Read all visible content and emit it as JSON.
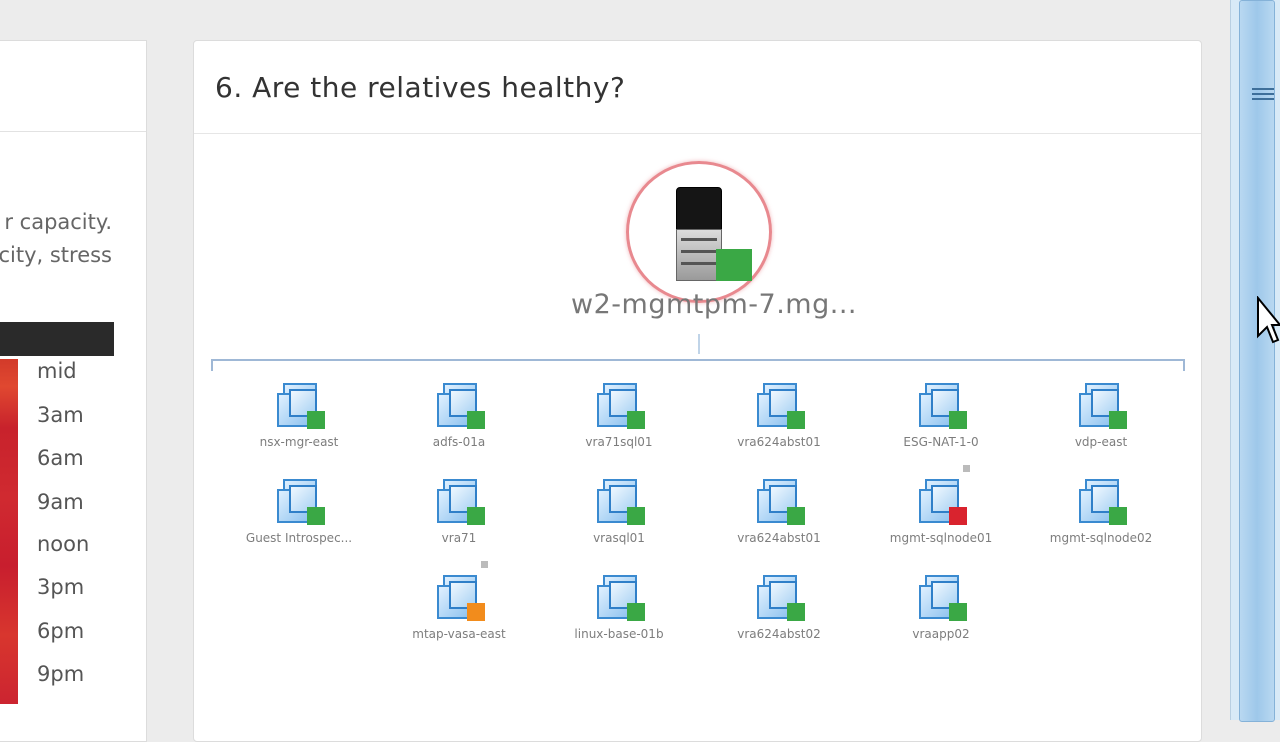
{
  "left_panel": {
    "text_lines": [
      "r capacity.",
      "city, stress"
    ],
    "time_labels": [
      "mid",
      "3am",
      "6am",
      "9am",
      "noon",
      "3pm",
      "6pm",
      "9pm"
    ]
  },
  "main_panel": {
    "title": "6. Are the relatives healthy?",
    "center_node": {
      "label": "w2-mgmtpm-7.mg...",
      "icon": "server-icon",
      "status": "green"
    },
    "vms": [
      {
        "label": "nsx-mgr-east",
        "status": "green"
      },
      {
        "label": "adfs-01a",
        "status": "green"
      },
      {
        "label": "vra71sql01",
        "status": "green"
      },
      {
        "label": "vra624abst01",
        "status": "green"
      },
      {
        "label": "ESG-NAT-1-0",
        "status": "green"
      },
      {
        "label": "vdp-east",
        "status": "green"
      },
      {
        "label": "Guest Introspec...",
        "status": "green"
      },
      {
        "label": "vra71",
        "status": "green"
      },
      {
        "label": "vrasql01",
        "status": "green"
      },
      {
        "label": "vra624abst01",
        "status": "green"
      },
      {
        "label": "mgmt-sqlnode01",
        "status": "red"
      },
      {
        "label": "mgmt-sqlnode02",
        "status": "green"
      },
      {
        "label": "mtap-vasa-east",
        "status": "orange"
      },
      {
        "label": "linux-base-01b",
        "status": "green"
      },
      {
        "label": "vra624abst02",
        "status": "green"
      },
      {
        "label": "vraapp02",
        "status": "green"
      }
    ]
  },
  "colors": {
    "status_green": "#3aa845",
    "status_red": "#d9232e",
    "status_orange": "#f28c1c",
    "ring": "#e8898f",
    "connector": "#9fb8d6"
  }
}
